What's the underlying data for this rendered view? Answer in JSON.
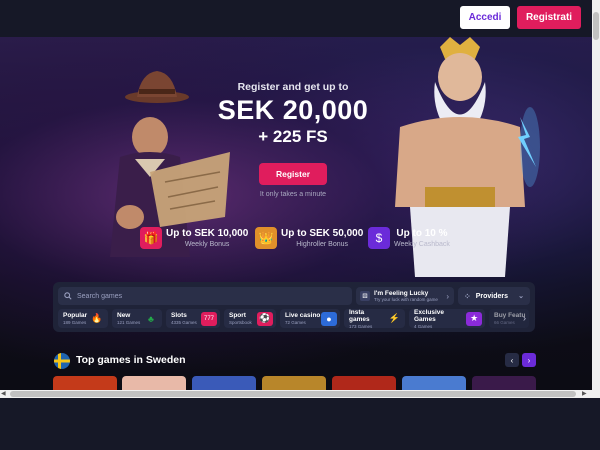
{
  "header": {
    "login_label": "Accedi",
    "register_label": "Registrati"
  },
  "hero": {
    "subtitle": "Register and get up to",
    "amount": "SEK 20,000",
    "free_spins": "+ 225 FS",
    "cta_label": "Register",
    "note": "It only takes a minute",
    "bonuses": [
      {
        "title": "Up to SEK 10,000",
        "caption": "Weekly Bonus",
        "icon": "gift-icon"
      },
      {
        "title": "Up to SEK 50,000",
        "caption": "Highroller Bonus",
        "icon": "crown-gift-icon"
      },
      {
        "title": "Up to 10 %",
        "caption": "Weekly Cashback",
        "icon": "cashback-icon"
      }
    ]
  },
  "search": {
    "placeholder": "Search games",
    "lucky_title": "I'm Feeling Lucky",
    "lucky_subtitle": "Try your luck with random game",
    "providers_label": "Providers"
  },
  "categories": [
    {
      "name": "Popular",
      "count": "189 Games",
      "icon": "flame-icon",
      "color": "#e8561c"
    },
    {
      "name": "New",
      "count": "121 Games",
      "icon": "clover-icon",
      "color": "#23a84a"
    },
    {
      "name": "Slots",
      "count": "4335 Games",
      "icon": "slot-machine-icon",
      "color": "#e01d5d"
    },
    {
      "name": "Sport",
      "count": "Sportsbook",
      "icon": "ball-icon",
      "color": "#e01d5d"
    },
    {
      "name": "Live casino",
      "count": "72 Games",
      "icon": "chip-icon",
      "color": "#2d6bd9"
    },
    {
      "name": "Insta games",
      "count": "173 Games",
      "icon": "lightning-icon",
      "color": "#d92ba8"
    },
    {
      "name": "Exclusive Games",
      "count": "4 Games",
      "icon": "star-icon",
      "color": "#8b2bd9"
    },
    {
      "name": "Buy Featu",
      "count": "66 Games",
      "icon": "cart-icon",
      "color": "#6b2bd9"
    }
  ],
  "top_games": {
    "title": "Top games in Sweden",
    "thumb_colors": [
      "#c43a1a",
      "#e8b9a8",
      "#3a5ab8",
      "#b8862a",
      "#b0281a",
      "#4a7bd0",
      "#3a1a4a"
    ]
  },
  "colors": {
    "accent": "#e01d5d",
    "purple": "#6b2bd9",
    "background": "#161827"
  }
}
